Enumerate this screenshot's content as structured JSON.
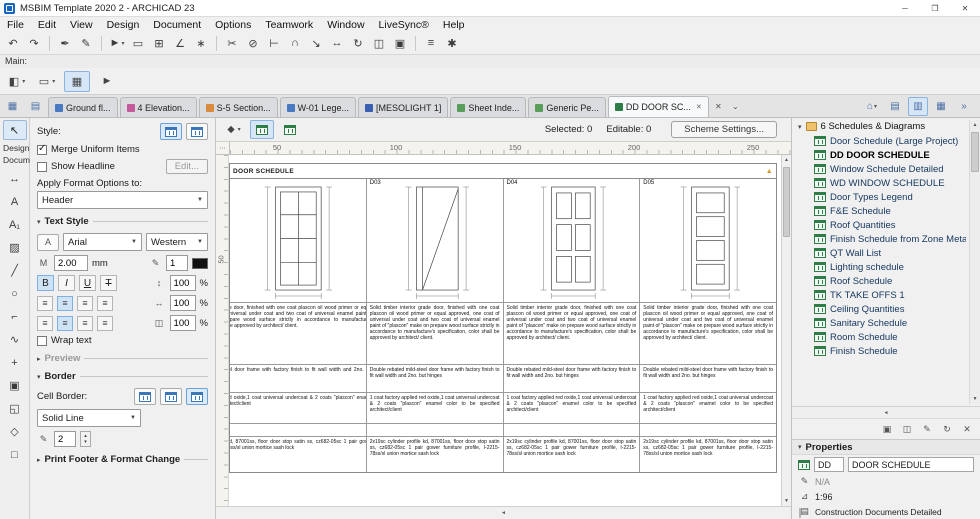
{
  "colors": {
    "accent": "#2b6cb8",
    "pressed_bg": "#d6e6f7",
    "schedule_icon_green": "#2e7d46",
    "tree_item_text": "#15365f",
    "ruler_bg": "#f4f3ee"
  },
  "window": {
    "title": "MSBIM Template 2020 2 - ARCHICAD 23",
    "controls": {
      "minimize": "─",
      "maximize": "❐",
      "close": "✕"
    },
    "menus": [
      "File",
      "Edit",
      "View",
      "Design",
      "Document",
      "Options",
      "Teamwork",
      "Window",
      "LiveSync®",
      "Help"
    ],
    "main_label": "Main:"
  },
  "toolbar1": {
    "glyphs": [
      "↶",
      "↷",
      "✒",
      "✎",
      "►",
      "▭",
      "⊞",
      "∠",
      "∗",
      "✂",
      "⊘",
      "⊢",
      "∩",
      "↘",
      "↔",
      "↻",
      "◫",
      "▣",
      "≡",
      "✱"
    ]
  },
  "toolbar2": {
    "glyphs": [
      "◧",
      "▭",
      "▦",
      "►"
    ]
  },
  "tabbar": {
    "left_icons": [
      "▦",
      "▤"
    ],
    "tabs": [
      {
        "label": "Ground fl..."
      },
      {
        "label": "4 Elevation..."
      },
      {
        "label": "S-5 Section..."
      },
      {
        "label": "W-01 Lege..."
      },
      {
        "label": "[MESOLIGHT 1]"
      },
      {
        "label": "Sheet Inde..."
      },
      {
        "label": "Generic Pe..."
      },
      {
        "label": "DD DOOR SC..."
      }
    ],
    "active_index": 7,
    "close_glyph": "✕",
    "list_glyph": "⌄"
  },
  "toolbox": {
    "select_glyph": "↖",
    "groups": [
      "Design",
      "Docume"
    ],
    "tools": [
      "↔",
      "A",
      "A₁",
      "▨",
      "╱",
      "○",
      "⌐",
      "∿",
      "+",
      "▣",
      "◱",
      "◇",
      "□"
    ]
  },
  "format_panel": {
    "style_label": "Style:",
    "merge_label": "Merge Uniform Items",
    "headline_label": "Show Headline",
    "edit_button": "Edit...",
    "apply_label": "Apply Format Options to:",
    "apply_value": "Header",
    "text_style_title": "Text Style",
    "font_name": "Arial",
    "font_script": "Western",
    "size_value": "2.00",
    "size_unit": "mm",
    "pen_value": "1",
    "bold": "B",
    "italic": "I",
    "underline": "U",
    "strike": "T",
    "align_glyph": "≡",
    "pct_values": [
      "100",
      "100",
      "100"
    ],
    "pct_unit": "%",
    "wrap_label": "Wrap text",
    "preview_title": "Preview",
    "border_title": "Border",
    "cell_border_label": "Cell Border:",
    "line_type": "Solid Line",
    "border_pen": "2",
    "print_title": "Print Footer & Format Change",
    "icons": {
      "font": "A",
      "size": "M",
      "pen": "✎",
      "row1": "↕",
      "row2": "↔",
      "row3": "◫"
    }
  },
  "canvas": {
    "pen_set_glyph": "◆",
    "selected": "Selected: 0",
    "editable": "Editable: 0",
    "scheme_button": "Scheme Settings...",
    "corner": "⋯",
    "ruler_h": [
      "50",
      "100",
      "150",
      "200",
      "250"
    ],
    "ruler_v": "50"
  },
  "schedule": {
    "title": "DOOR SCHEDULE",
    "codes": [
      "D03",
      "D04",
      "D05"
    ],
    "desc": "Solid timber interior grade door, finished with one coat plascon oil wood primer or equal approved, one coat of universal under coat and two coat of universal enamel paint of \"plascon\" make on prepare wood surface strictly in accordance to manufacture's specification, color shall be approved by architect/ client.",
    "frame": "Double rebated mild-steel door frame with factory finish to fit wall width and 2no. but hinges",
    "finish": "1 coat factory applied red oxide,1 coat universal undercoat & 2 coats \"plascon\" enamel color to be specified architect/client",
    "ironmongery": "2x19sc cylinder profile kd, 87001ss, floor door stop satin ss, cz682-05sc 1 pair gower furniture profile, I-2215-78ss/sl union mortice sash lock"
  },
  "navigator": {
    "root": "6 Schedules & Diagrams",
    "selected_index": 1,
    "items": [
      "Door Schedule (Large Project)",
      "DD DOOR SCHEDULE",
      "Window Schedule Detailed",
      "WD WINDOW SCHEDULE",
      "Door Types Legend",
      "F&E Schedule",
      "Roof Quantities",
      "Finish Schedule from Zone Metac",
      "QT Wall List",
      "Lighting schedule",
      "Roof Schedule",
      "TK TAKE OFFS 1",
      "Ceiling Quantities",
      "Sanitary Schedule",
      "Room Schedule",
      "Finish Schedule"
    ]
  },
  "nav_icons": {
    "top": [
      "⌂",
      "▤",
      "▥",
      "▦",
      "»"
    ],
    "bottom": [
      "▣",
      "◫",
      "✎",
      "↻",
      "✕"
    ]
  },
  "properties": {
    "title": "Properties",
    "id": "DD",
    "name": "DOOR SCHEDULE",
    "pen": "N/A",
    "scale": "1:96",
    "docset": "Construction Documents Detailed"
  }
}
